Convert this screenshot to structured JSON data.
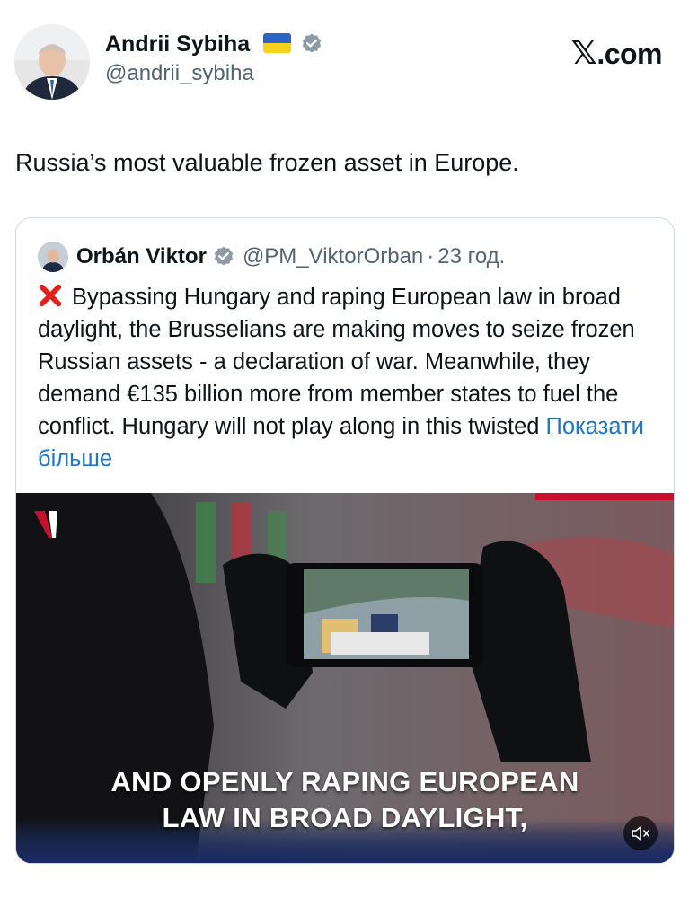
{
  "author": {
    "name": "Andrii Sybiha",
    "handle": "@andrii_sybiha",
    "flag_icon": "ukraine-flag-icon",
    "verified_icon": "verified-badge-icon"
  },
  "site": {
    "logo_x": "𝕏",
    "logo_text": ".com"
  },
  "tweet": {
    "text": "Russia’s most valuable frozen asset in Europe."
  },
  "quoted_tweet": {
    "name": "Orbán Viktor",
    "handle": "@PM_ViktorOrban",
    "separator": "·",
    "time": "23 год.",
    "body": "Bypassing Hungary and raping European law in broad daylight, the Brusselians are making moves to seize frozen Russian assets - a declaration of war. Meanwhile, they demand €135 billion more from member states to fuel the conflict. Hungary will not play along in this twisted",
    "show_more": "Показати більше",
    "media": {
      "caption_line1": "AND OPENLY RAPING EUROPEAN",
      "caption_line2": "LAW IN BROAD DAYLIGHT,",
      "mute_icon": "speaker-muted-icon"
    }
  },
  "colors": {
    "text": "#0f1419",
    "secondary": "#536471",
    "link": "#1d76c7",
    "verified": "#8e9aa6",
    "border": "#cfd9de",
    "x_mark": "#e0211b"
  }
}
